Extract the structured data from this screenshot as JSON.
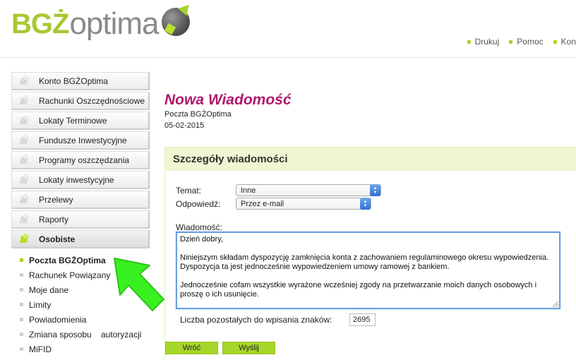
{
  "header": {
    "logo_bgz": "BGŻ",
    "logo_optima": "optima",
    "links": [
      {
        "label": "Drukuj"
      },
      {
        "label": "Pomoc"
      },
      {
        "label": "Kon"
      }
    ]
  },
  "sidebar": {
    "items": [
      {
        "label": "Konto BGŻOptima"
      },
      {
        "label": "Rachunki Oszczędnościowe"
      },
      {
        "label": "Lokaty Terminowe"
      },
      {
        "label": "Fundusze Inwestycyjne"
      },
      {
        "label": "Programy oszczędzania"
      },
      {
        "label": "Lokaty inwestycyjne"
      },
      {
        "label": "Przelewy"
      },
      {
        "label": "Raporty"
      },
      {
        "label": "Osobiste"
      }
    ],
    "subitems": [
      {
        "label": "Poczta BGŻOptima"
      },
      {
        "label": "Rachunek Powiązany"
      },
      {
        "label": "Moje dane"
      },
      {
        "label": "Limity"
      },
      {
        "label": "Powiadomienia"
      },
      {
        "label": "Zmiana sposobu    autoryzacji"
      },
      {
        "label": "MiFID"
      }
    ]
  },
  "main": {
    "title": "Nowa Wiadomość",
    "source": "Poczta BGŻOptima",
    "date": "05-02-2015",
    "panel_title": "Szczegóły wiadomości",
    "temat_label": "Temat:",
    "temat_value": "Inne",
    "odpowiedz_label": "Odpowiedź:",
    "odpowiedz_value": "Przez e-mail",
    "wiadomosc_label": "Wiadomość:",
    "message": "Dzień dobry,\n\nNiniejszym składam dyspozycję zamknięcia konta z zachowaniem regulaminowego okresu wypowiedzenia. Dyspozycja ta jest jednocześnie wypowiedzeniem umowy ramowej z bankiem.\n\nJednocześnie cofam wszystkie wyrażone wcześniej zgody na przetwarzanie moich danych osobowych i proszę o ich usunięcie.",
    "count_label": "Liczba pozostałych do wpisania znaków:",
    "count_value": "2695",
    "back_button": "Wróć",
    "send_button": "Wyślij"
  },
  "colors": {
    "accent_green": "#a6d62a",
    "title_magenta": "#b0176c",
    "panel_header": "#eef6d2",
    "arrow_green": "#33ee22"
  },
  "icons": [
    "logo-ball-icon",
    "menu-square-icon",
    "select-arrow-icon",
    "green-arrow-icon"
  ]
}
